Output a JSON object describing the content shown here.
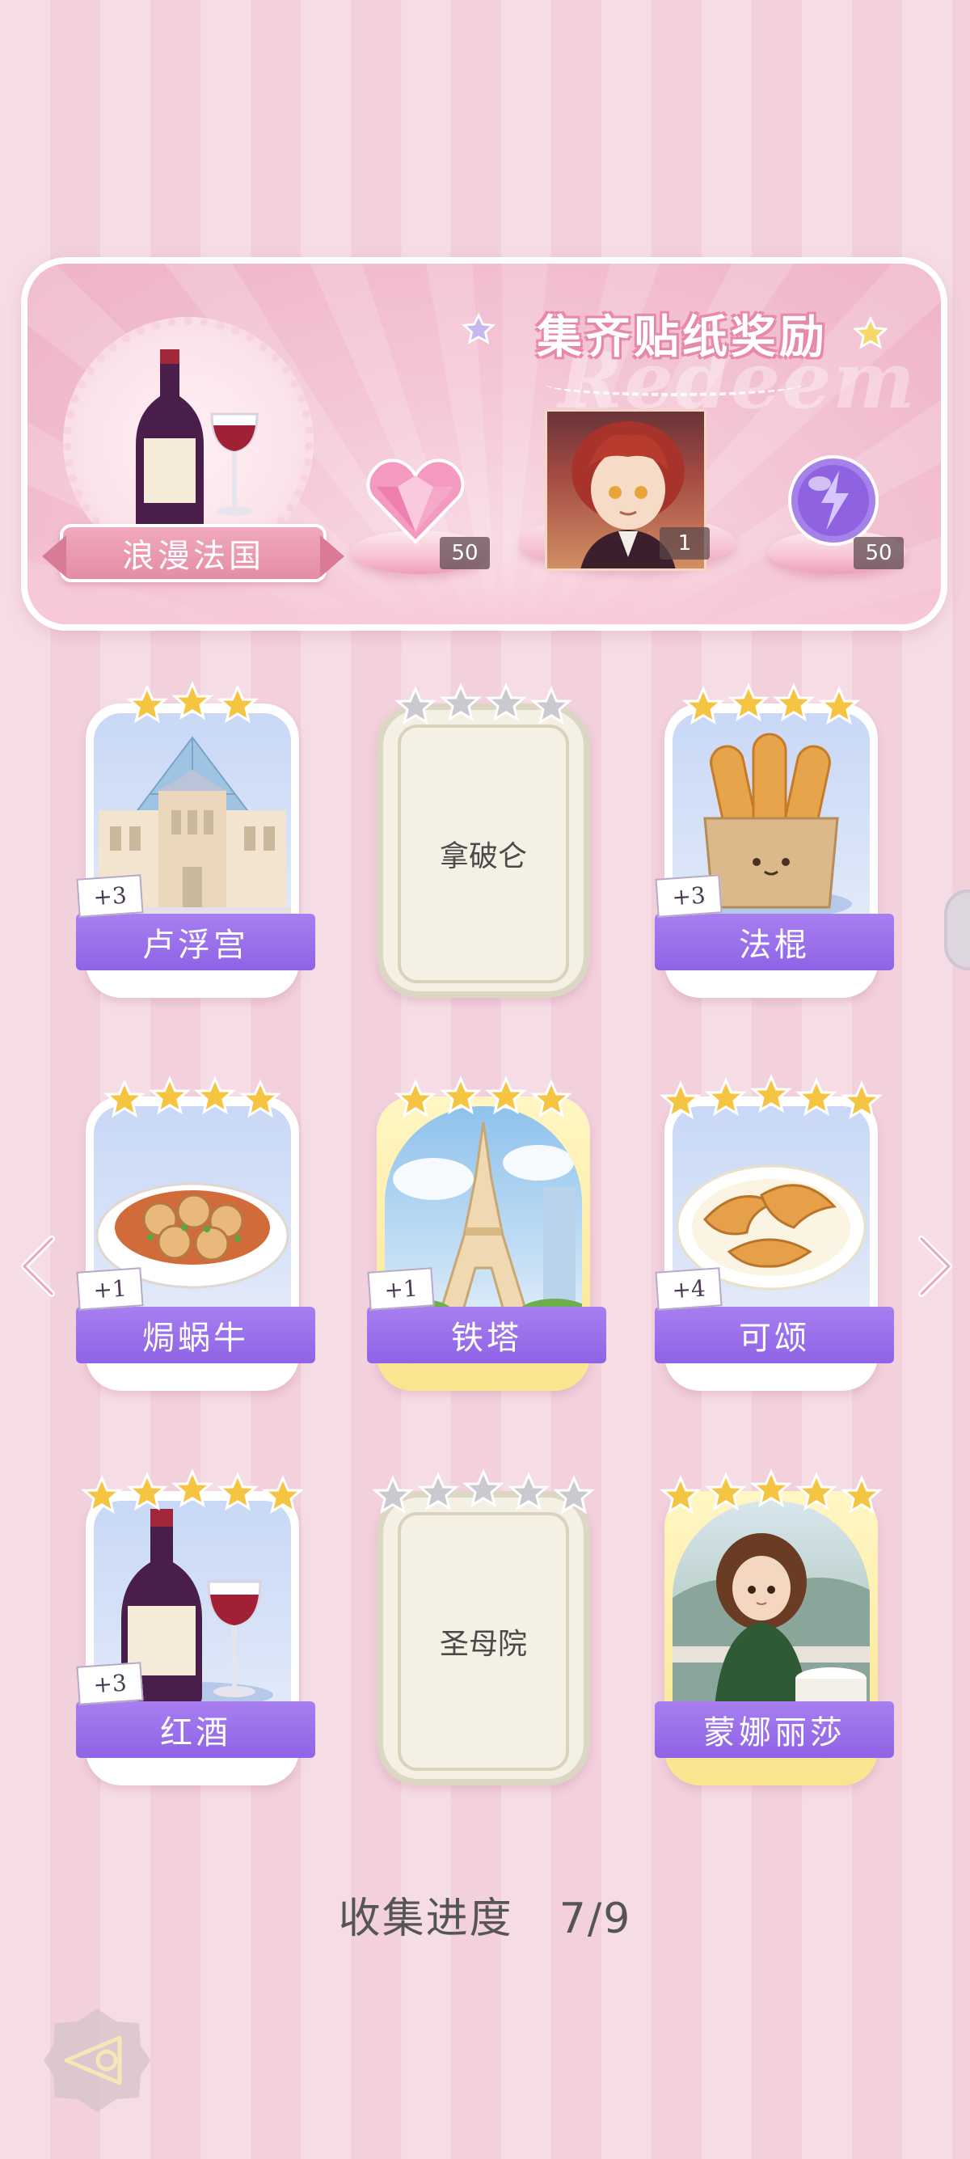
{
  "banner": {
    "region_name": "浪漫法国",
    "title": "集齐贴纸奖励",
    "watermark": "Redeem",
    "rewards": [
      {
        "icon": "pink-diamond-icon",
        "quantity": "50"
      },
      {
        "icon": "character-portrait",
        "quantity": "1"
      },
      {
        "icon": "energy-orb-icon",
        "quantity": "50"
      }
    ]
  },
  "stickers": [
    {
      "name": "卢浮宫",
      "stars": 3,
      "dup": "+3",
      "locked": false,
      "frame": "normal",
      "art": "louvre"
    },
    {
      "name": "拿破仑",
      "stars": 4,
      "dup": "",
      "locked": true,
      "frame": "locked",
      "art": ""
    },
    {
      "name": "法棍",
      "stars": 4,
      "dup": "+3",
      "locked": false,
      "frame": "normal",
      "art": "baguette"
    },
    {
      "name": "焗蜗牛",
      "stars": 4,
      "dup": "+1",
      "locked": false,
      "frame": "normal",
      "art": "escargot"
    },
    {
      "name": "铁塔",
      "stars": 4,
      "dup": "+1",
      "locked": false,
      "frame": "gold",
      "art": "eiffel"
    },
    {
      "name": "可颂",
      "stars": 5,
      "dup": "+4",
      "locked": false,
      "frame": "normal",
      "art": "croissant"
    },
    {
      "name": "红酒",
      "stars": 5,
      "dup": "+3",
      "locked": false,
      "frame": "normal",
      "art": "wine"
    },
    {
      "name": "圣母院",
      "stars": 5,
      "dup": "",
      "locked": true,
      "frame": "locked",
      "art": ""
    },
    {
      "name": "蒙娜丽莎",
      "stars": 5,
      "dup": "",
      "locked": false,
      "frame": "gold",
      "art": "monalisa"
    }
  ],
  "progress": {
    "label": "收集进度",
    "value": "7/9"
  },
  "colors": {
    "label_purple": "#9468e8",
    "star_gold": "#f5c542",
    "star_silver": "#c9c9cf",
    "banner_pink": "#f4c6d6"
  }
}
